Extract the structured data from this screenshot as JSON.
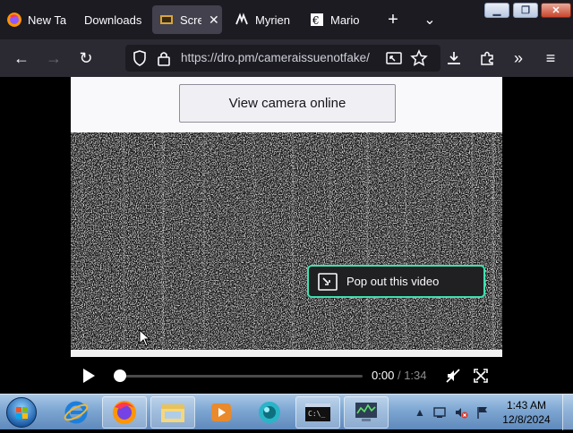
{
  "browser": {
    "tabs": [
      {
        "label": "New Ta",
        "icon": "firefox-icon",
        "active": false
      },
      {
        "label": "Downloads",
        "icon": "",
        "active": false
      },
      {
        "label": "Scre",
        "icon": "video-tab-icon",
        "active": true
      },
      {
        "label": "Myrien",
        "icon": "myrient-icon",
        "active": false
      },
      {
        "label": "Mario",
        "icon": "mario-icon",
        "active": false
      }
    ],
    "new_tab_glyph": "+",
    "tab_list_glyph": "⌄",
    "url": "https://dro.pm/cameraissuenotfake/",
    "accent": "#3fe1b0"
  },
  "page": {
    "view_camera_label": "View camera online",
    "popout_label": "Pop out this video"
  },
  "video_player": {
    "current_time": "0:00",
    "separator": "/",
    "duration": "1:34",
    "progress": 0
  },
  "taskbar": {
    "time": "1:43 AM",
    "date": "12/8/2024",
    "apps": [
      "start-orb",
      "internet-explorer",
      "firefox",
      "file-explorer",
      "media-player",
      "app-blue-circle",
      "command-prompt",
      "network-monitor"
    ]
  }
}
